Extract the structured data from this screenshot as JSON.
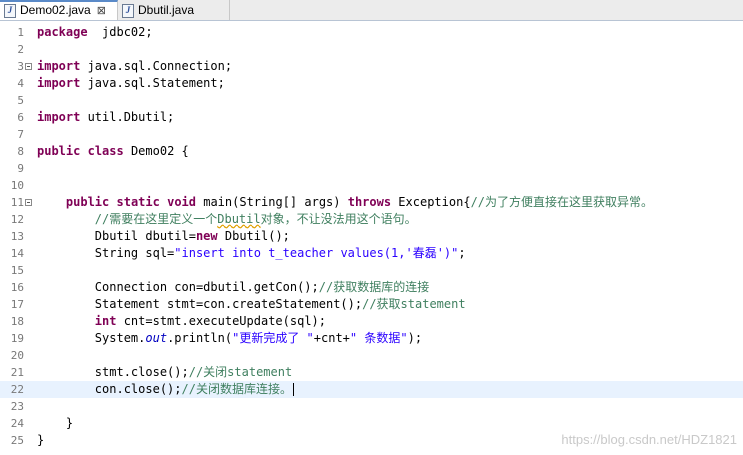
{
  "tabs": [
    {
      "label": "Demo02.java",
      "close": "⊠",
      "icon": "java-file-icon",
      "active": true
    },
    {
      "label": "Dbutil.java",
      "icon": "java-file-icon",
      "active": false
    }
  ],
  "lines": [
    {
      "n": "1",
      "t": [
        [
          "kw",
          "package"
        ],
        [
          "",
          "  jdbc02;"
        ]
      ]
    },
    {
      "n": "2",
      "t": []
    },
    {
      "n": "3",
      "t": [
        [
          "kw",
          "import"
        ],
        [
          "",
          " java.sql.Connection;"
        ]
      ]
    },
    {
      "n": "4",
      "t": [
        [
          "kw",
          "import"
        ],
        [
          "",
          " java.sql.Statement;"
        ]
      ]
    },
    {
      "n": "5",
      "t": []
    },
    {
      "n": "6",
      "t": [
        [
          "kw",
          "import"
        ],
        [
          "",
          " util.Dbutil;"
        ]
      ]
    },
    {
      "n": "7",
      "t": []
    },
    {
      "n": "8",
      "t": [
        [
          "kw",
          "public"
        ],
        [
          "",
          " "
        ],
        [
          "kw",
          "class"
        ],
        [
          "",
          " Demo02 {"
        ]
      ]
    },
    {
      "n": "9",
      "t": []
    },
    {
      "n": "10",
      "t": []
    },
    {
      "n": "11",
      "t": [
        [
          "",
          "    "
        ],
        [
          "kw",
          "public"
        ],
        [
          "",
          " "
        ],
        [
          "kw",
          "static"
        ],
        [
          "",
          " "
        ],
        [
          "kw",
          "void"
        ],
        [
          "",
          " main(String[] args) "
        ],
        [
          "kw",
          "throws"
        ],
        [
          "",
          " Exception{"
        ],
        [
          "cm",
          "//为了方便直接在这里获取异常。"
        ]
      ]
    },
    {
      "n": "12",
      "t": [
        [
          "",
          "        "
        ],
        [
          "cm",
          "//需要在这里定义一个"
        ],
        [
          "cm squiggle",
          "Dbutil"
        ],
        [
          "cm",
          "对象，不让没法用这个语句。"
        ]
      ]
    },
    {
      "n": "13",
      "t": [
        [
          "",
          "        Dbutil dbutil="
        ],
        [
          "kw",
          "new"
        ],
        [
          "",
          " Dbutil();"
        ]
      ]
    },
    {
      "n": "14",
      "t": [
        [
          "",
          "        String sql="
        ],
        [
          "str",
          "\"insert into t_teacher values(1,'春磊')\""
        ],
        [
          "",
          ";"
        ]
      ]
    },
    {
      "n": "15",
      "t": []
    },
    {
      "n": "16",
      "t": [
        [
          "",
          "        Connection con=dbutil.getCon();"
        ],
        [
          "cm",
          "//获取数据库的连接"
        ]
      ]
    },
    {
      "n": "17",
      "t": [
        [
          "",
          "        Statement stmt=con.createStatement();"
        ],
        [
          "cm",
          "//获取statement"
        ]
      ]
    },
    {
      "n": "18",
      "t": [
        [
          "",
          "        "
        ],
        [
          "kw",
          "int"
        ],
        [
          "",
          " cnt=stmt.executeUpdate(sql);"
        ]
      ]
    },
    {
      "n": "19",
      "t": [
        [
          "",
          "        System."
        ],
        [
          "fld",
          "out"
        ],
        [
          "",
          ".println("
        ],
        [
          "str",
          "\"更新完成了 \""
        ],
        [
          "",
          "+cnt+"
        ],
        [
          "str",
          "\" 条数据\""
        ],
        [
          "",
          ");"
        ]
      ]
    },
    {
      "n": "20",
      "t": []
    },
    {
      "n": "21",
      "t": [
        [
          "",
          "        stmt.close();"
        ],
        [
          "cm",
          "//关闭statement"
        ]
      ]
    },
    {
      "n": "22",
      "t": [
        [
          "",
          "        con.close();"
        ],
        [
          "cm",
          "//关闭数据库连接。"
        ]
      ]
    },
    {
      "n": "23",
      "t": []
    },
    {
      "n": "24",
      "t": [
        [
          "",
          "    }"
        ]
      ]
    },
    {
      "n": "25",
      "t": [
        [
          "",
          "}"
        ]
      ]
    }
  ],
  "current_line": "22",
  "folds": [
    "3",
    "11"
  ],
  "watermark": "https://blog.csdn.net/HDZ1821"
}
